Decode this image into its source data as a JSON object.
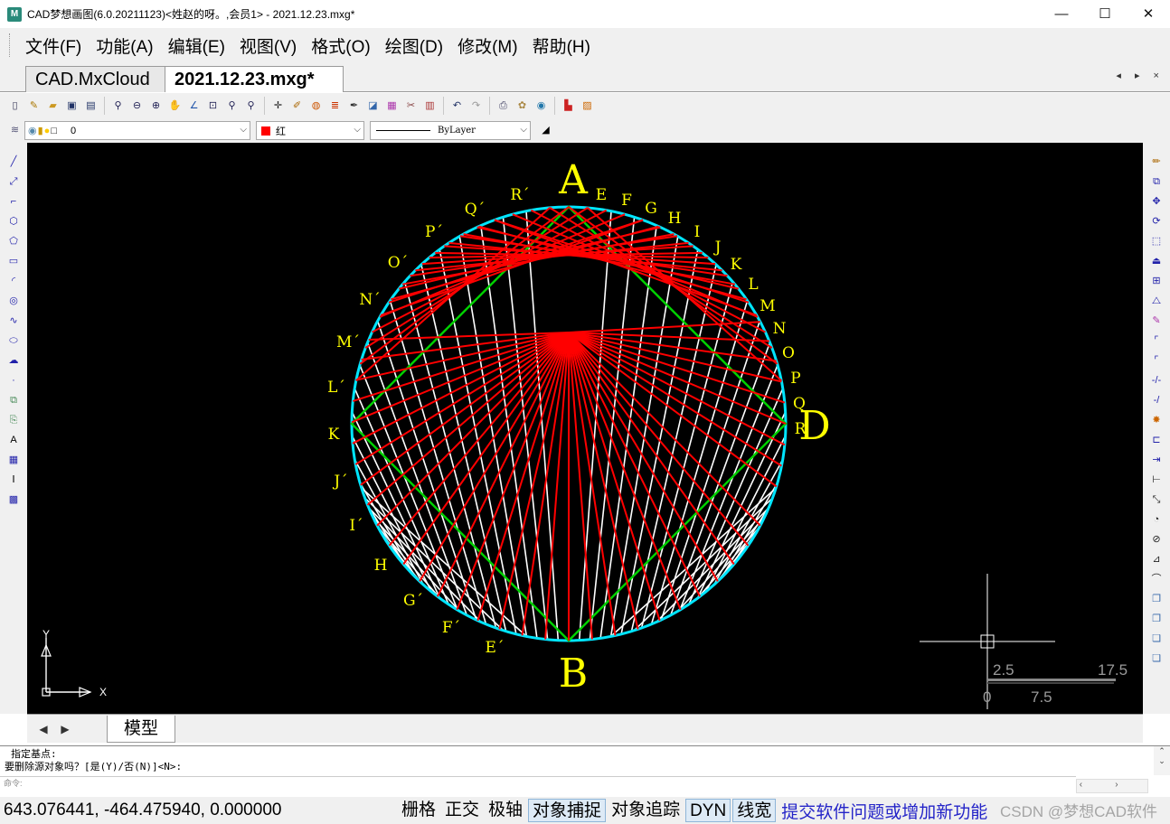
{
  "window": {
    "title": "CAD梦想画图(6.0.20211123)<姓赵的呀。,会员1> - 2021.12.23.mxg*",
    "app_icon": "M",
    "minimize_glyph": "—",
    "maximize_glyph": "☐",
    "close_glyph": "✕"
  },
  "menu": {
    "items": [
      "文件(F)",
      "功能(A)",
      "编辑(E)",
      "视图(V)",
      "格式(O)",
      "绘图(D)",
      "修改(M)",
      "帮助(H)"
    ]
  },
  "doc_tabs": {
    "tabs": [
      {
        "label": "CAD.MxCloud",
        "active": false
      },
      {
        "label": "2021.12.23.mxg*",
        "active": true
      }
    ],
    "nav": "◂ ▸ ×"
  },
  "property_bar": {
    "layer_value": "0",
    "color_value": "红",
    "color_hex": "#ff0000",
    "linetype_value": "ByLayer"
  },
  "drawing": {
    "point_labels": {
      "top": "A",
      "bottom": "B",
      "right": "D",
      "right_arc": [
        "E",
        "F",
        "G",
        "H",
        "I",
        "J",
        "K",
        "L",
        "M",
        "N",
        "O",
        "P",
        "Q",
        "R"
      ],
      "left_arc": [
        "R´",
        "Q´",
        "P´",
        "O´",
        "N´",
        "M´",
        "L´",
        "K",
        "J´",
        "I´",
        "H",
        "G´",
        "F´",
        "E´"
      ]
    },
    "colors": {
      "circle": "#00e5ff",
      "chords_white": "#ffffff",
      "chords_red": "#ff0000",
      "square": "#00d000",
      "labels": "#ffff00",
      "background": "#000000"
    },
    "scale_bar": {
      "labels_top": [
        "2.5",
        "17.5"
      ],
      "labels_bottom": [
        "0",
        "7.5"
      ]
    },
    "ucs": {
      "x_label": "X",
      "y_label": "Y"
    }
  },
  "layout_tabs": {
    "prev_glyph": "◀",
    "next_glyph": "▶",
    "model_tab": "模型"
  },
  "command": {
    "history": [
      "指定基点:",
      "要删除源对象吗？[是(Y)/否(N)]<N>:"
    ],
    "prompt": "命令:"
  },
  "status": {
    "coordinates": "643.076441,  -464.475940,  0.000000",
    "toggles": [
      {
        "label": "栅格",
        "on": false
      },
      {
        "label": "正交",
        "on": false
      },
      {
        "label": "极轴",
        "on": false
      },
      {
        "label": "对象捕捉",
        "on": true
      },
      {
        "label": "对象追踪",
        "on": false
      },
      {
        "label": "DYN",
        "on": true
      },
      {
        "label": "线宽",
        "on": true
      }
    ],
    "feedback_link": "提交软件问题或增加新功能",
    "watermark": "CSDN @梦想CAD软件"
  },
  "icons": {
    "top_toolbar": [
      "new-file-icon",
      "open-file-icon",
      "open-folder-icon",
      "save-icon",
      "save-as-icon",
      "zoom-realtime-icon",
      "zoom-out-icon",
      "zoom-in-icon",
      "pan-hand-icon",
      "measure-angle-icon",
      "zoom-extents-icon",
      "zoom-window-icon",
      "zoom-previous-icon",
      "move-cross-icon",
      "brush-icon",
      "palette-icon",
      "layers-icon",
      "match-prop-icon",
      "edit-window-icon",
      "render-icon",
      "erase-icon",
      "properties-icon",
      "undo-icon",
      "redo-icon",
      "print-icon",
      "plugin-icon",
      "web-icon",
      "pdf-icon",
      "image-icon"
    ],
    "left_toolbar": [
      "line-icon",
      "xline-icon",
      "polyline-icon",
      "polygon-icon",
      "pentagon-icon",
      "rectangle-icon",
      "arc-icon",
      "circle-icon",
      "spline-icon",
      "ellipse-icon",
      "revcloud-icon",
      "point-icon",
      "block-icon",
      "insert-icon",
      "text-icon",
      "table-icon",
      "mtext-icon",
      "hatch-icon"
    ],
    "right_toolbar": [
      "pencil-icon",
      "copy-icon",
      "move-icon",
      "rotate-icon",
      "scale-icon",
      "stamp-icon",
      "array-icon",
      "mirror-icon",
      "paint-icon",
      "fillet-icon",
      "chamfer-icon",
      "trim-icon",
      "extend-icon",
      "explode-icon",
      "stretch-icon",
      "break-icon",
      "dim-linear-icon",
      "dim-aligned-icon",
      "dim-radius-icon",
      "dim-diameter-icon",
      "dim-angle-icon",
      "dim-arc-icon",
      "layer-top-icon",
      "layer-bottom-icon",
      "layer-front-icon",
      "layer-back-icon"
    ]
  }
}
